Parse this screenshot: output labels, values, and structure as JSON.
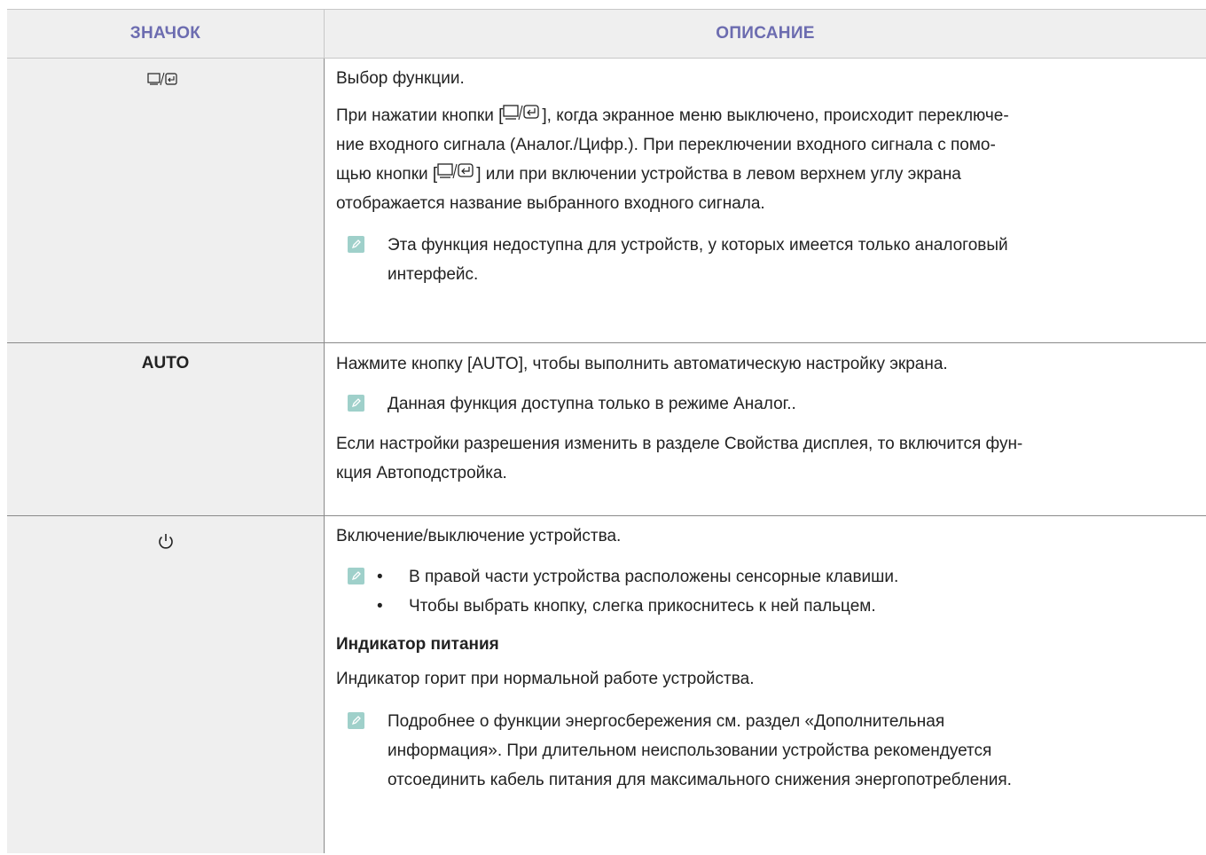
{
  "header": {
    "col_icon": "ЗНАЧОК",
    "col_desc": "ОПИСАНИЕ"
  },
  "rows": [
    {
      "icon": "source-enter-icon",
      "title": "Выбор функции.",
      "para_start": "При нажатии кнопки [",
      "para_mid1": "], когда экранное меню выключено, происходит переключе-",
      "para_line2": "ние входного сигнала (Аналог./Цифр.). При переключении входного сигнала с помо-",
      "para_line3a": "щью кнопки [",
      "para_line3b": "] или при включении устройства в левом верхнем углу экрана",
      "para_line4": "отображается название выбранного входного сигнала.",
      "note_line1": "Эта функция недоступна для устройств, у которых имеется только аналоговый",
      "note_line2": "интерфейс."
    },
    {
      "icon_label": "AUTO",
      "line1": "Нажмите кнопку [AUTO], чтобы выполнить автоматическую настройку экрана.",
      "note": "Данная функция доступна только в режиме Аналог..",
      "line2a": "Если настройки разрешения изменить в разделе Свойства дисплея, то включится фун-",
      "line2b": "кция Автоподстройка."
    },
    {
      "icon": "power-icon",
      "line1": "Включение/выключение устройства.",
      "bullet1": "В правой части устройства расположены сенсорные клавиши.",
      "bullet2": "Чтобы выбрать кнопку, слегка прикоснитесь к ней пальцем.",
      "subhead": "Индикатор питания",
      "line2": "Индикатор горит при нормальной работе устройства.",
      "note_line1": "Подробнее о функции энергосбережения см. раздел «Дополнительная",
      "note_line2": "информация». При длительном неиспользовании устройства рекомендуется",
      "note_line3": "отсоединить кабель питания для максимального снижения энергопотребления."
    }
  ],
  "colors": {
    "header_text": "#6c6cb0",
    "note_icon": "#9fd0ca",
    "icon_col_bg": "#efefef"
  }
}
